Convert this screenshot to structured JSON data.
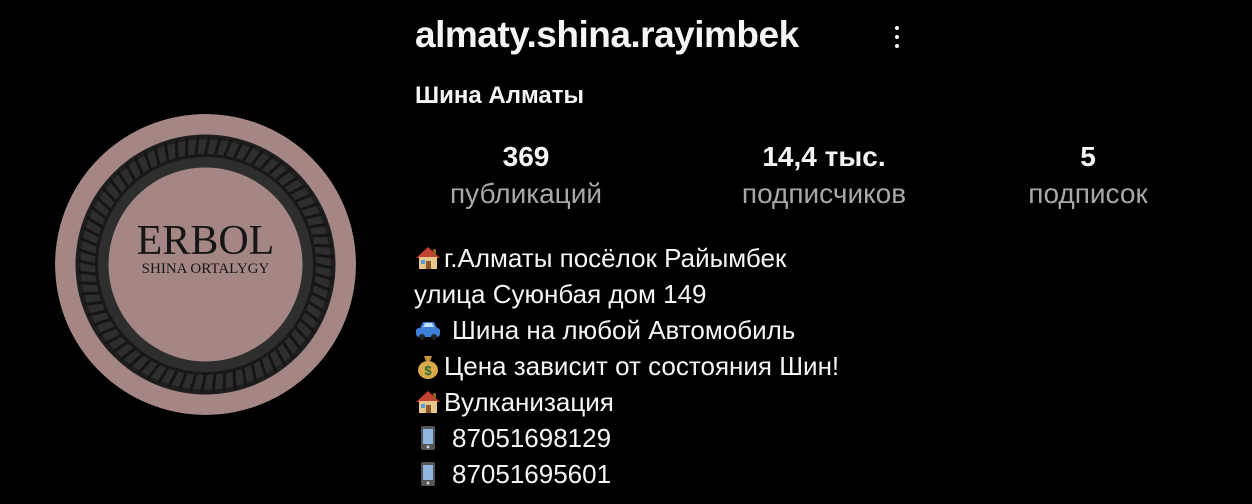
{
  "profile": {
    "username": "almaty.shina.rayimbek",
    "full_name": "Шина Алматы",
    "avatar": {
      "title": "ERBOL",
      "subtitle": "SHINA ORTALYGY"
    }
  },
  "stats": {
    "posts": {
      "value": "369",
      "label": "публикаций"
    },
    "followers": {
      "value": "14,4 тыс.",
      "label": "подписчиков"
    },
    "following": {
      "value": "5",
      "label": "подписок"
    }
  },
  "bio": {
    "lines": [
      {
        "icon": "house-icon",
        "text": "г.Алматы посёлок Райымбек"
      },
      {
        "icon": "",
        "text": "улица Суюнбая дом 149"
      },
      {
        "icon": "car-icon",
        "text": "Шина на любой Автомобиль"
      },
      {
        "icon": "money-bag-icon",
        "text": "Цена зависит от состояния Шин!"
      },
      {
        "icon": "house-icon",
        "text": "Вулканизация"
      },
      {
        "icon": "phone-icon",
        "text": "87051698129"
      },
      {
        "icon": "phone-icon",
        "text": "87051695601"
      }
    ]
  },
  "colors": {
    "background": "#000000",
    "text_primary": "#f5f5f5",
    "text_secondary": "#a8a8a8",
    "avatar_rim": "#a48784",
    "avatar_tire": "#2a2a2a"
  }
}
